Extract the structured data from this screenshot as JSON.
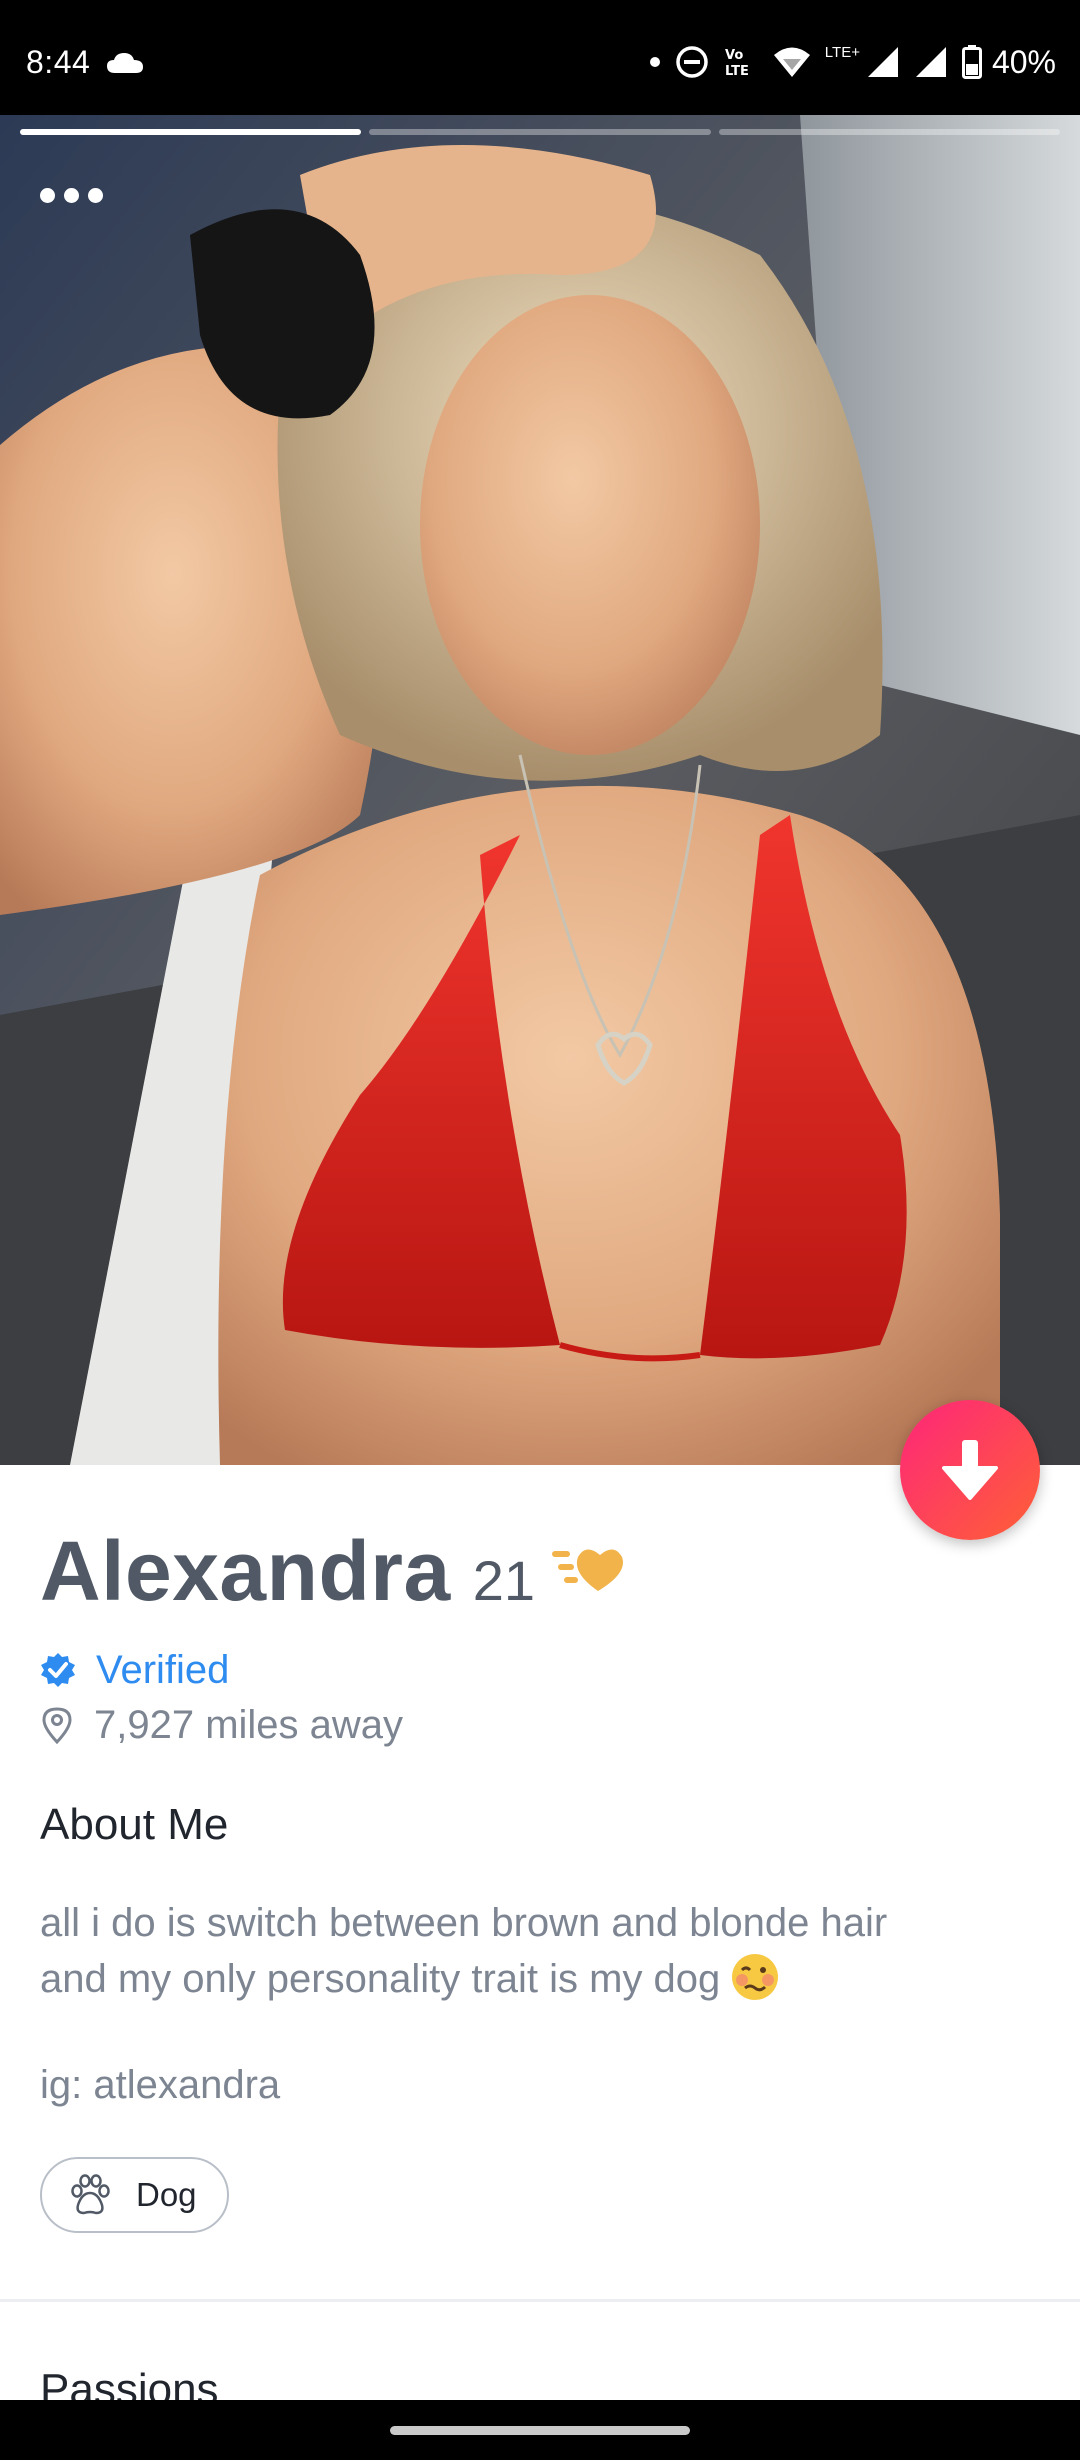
{
  "status_bar": {
    "time": "8:44",
    "battery": "40%",
    "icons": [
      "cloud-icon",
      "dot-icon",
      "do-not-disturb-icon",
      "volte-icon",
      "wifi-icon",
      "signal-lte-icon",
      "signal-icon",
      "battery-icon"
    ],
    "network_label": "LTE+",
    "volte_label_top": "Vo",
    "volte_label_bottom": "LTE"
  },
  "photo": {
    "segments": 3,
    "active_segment": 1,
    "more_icon": "more-horizontal-icon"
  },
  "profile": {
    "name": "Alexandra",
    "age": "21",
    "vibe_icon": "heart-swipe-icon",
    "verified_label": "Verified",
    "distance": "7,927 miles away",
    "about_title": "About Me",
    "bio_line1": "all i do is switch between brown and blonde hair",
    "bio_line2": "and my only personality trait is my dog",
    "bio_emoji": "woozy-face-emoji",
    "instagram": "ig: atlexandra",
    "chip_label": "Dog",
    "chip_icon": "paw-icon",
    "passions_title": "Passions"
  },
  "colors": {
    "accent_pink": "#fd267a",
    "accent_orange": "#ff6036",
    "verified_blue": "#2e8bf0",
    "text_gray": "#7c8591",
    "name_gray": "#505965"
  }
}
